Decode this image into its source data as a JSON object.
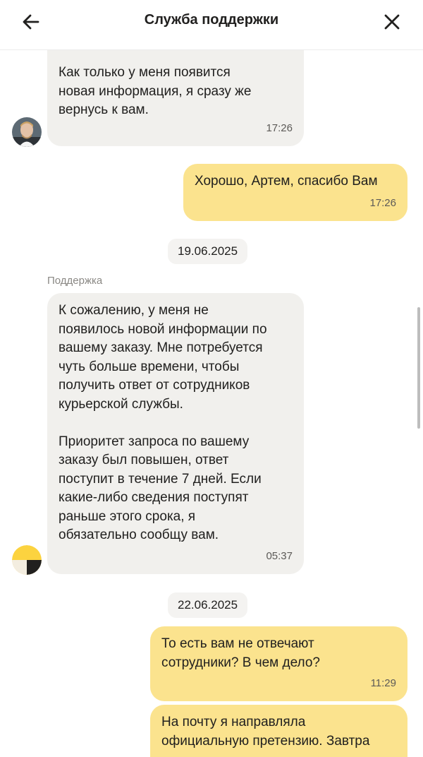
{
  "header": {
    "title": "Служба поддержки",
    "back_icon": "arrow-left-icon",
    "close_icon": "close-icon"
  },
  "colors": {
    "incoming_bubble": "#f1f0ed",
    "outgoing_bubble": "#fbe38e",
    "brand_yellow": "#fcd33f"
  },
  "messages": [
    {
      "text": "Как только у меня появится\nновая информация, я сразу же\nвернусь к вам.",
      "time": "17:26"
    },
    {
      "text": "Хорошо, Артем, спасибо Вам",
      "time": "17:26"
    },
    {
      "text": "К сожалению, у меня не\nпоявилось новой информации по\nвашему заказу. Мне потребуется\nчуть больше времени, чтобы\nполучить ответ от сотрудников\nкурьерской службы.\n\nПриоритет запроса по вашему\nзаказу был повышен, ответ\nпоступит в течение 7 дней. Если\nкакие-либо сведения поступят\nраньше этого срока, я\nобязательно сообщу вам.",
      "time": "05:37"
    },
    {
      "text": "То есть вам не отвечают\nсотрудники? В чем дело?",
      "time": "11:29"
    },
    {
      "text": "На почту я направляла\nофициальную претензию. Завтра"
    }
  ],
  "dates": [
    "19.06.2025",
    "22.06.2025"
  ],
  "sender_label": "Поддержка"
}
